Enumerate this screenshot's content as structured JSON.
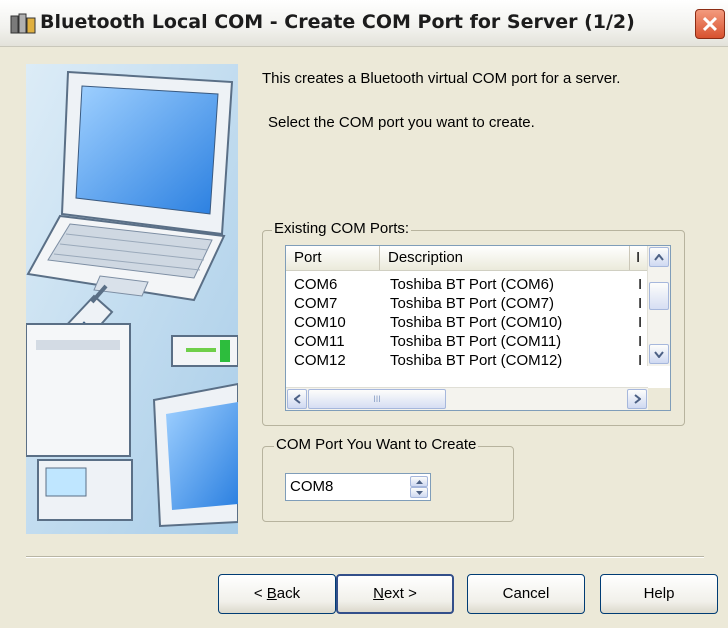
{
  "window": {
    "title": "Bluetooth Local COM - Create COM Port for Server (1/2)",
    "close_label": "✕"
  },
  "intro": {
    "line1": "This creates a Bluetooth virtual COM port for a server.",
    "line2": "Select the COM port you want to create."
  },
  "existing_ports": {
    "group_label": "Existing COM Ports:",
    "columns": [
      "Port",
      "Description",
      "I"
    ],
    "rows": [
      {
        "port": "COM6",
        "description": "Toshiba BT Port (COM6)",
        "extra": "I"
      },
      {
        "port": "COM7",
        "description": "Toshiba BT Port (COM7)",
        "extra": "I"
      },
      {
        "port": "COM10",
        "description": "Toshiba BT Port (COM10)",
        "extra": "I"
      },
      {
        "port": "COM11",
        "description": "Toshiba BT Port (COM11)",
        "extra": "I"
      },
      {
        "port": "COM12",
        "description": "Toshiba BT Port (COM12)",
        "extra": "I"
      }
    ],
    "hscroll_grip": "III"
  },
  "create_port": {
    "group_label": "COM Port You Want to Create",
    "value": "COM8"
  },
  "buttons": {
    "back": {
      "prefix": "< ",
      "mnemonic": "B",
      "rest": "ack"
    },
    "next": {
      "mnemonic": "N",
      "rest": "ext >"
    },
    "cancel": "Cancel",
    "help": "Help"
  },
  "icons": [
    "app-bluetooth-icon",
    "close-icon",
    "scroll-up-icon",
    "scroll-down-icon",
    "scroll-left-icon",
    "scroll-right-icon",
    "spin-up-icon",
    "spin-down-icon"
  ]
}
